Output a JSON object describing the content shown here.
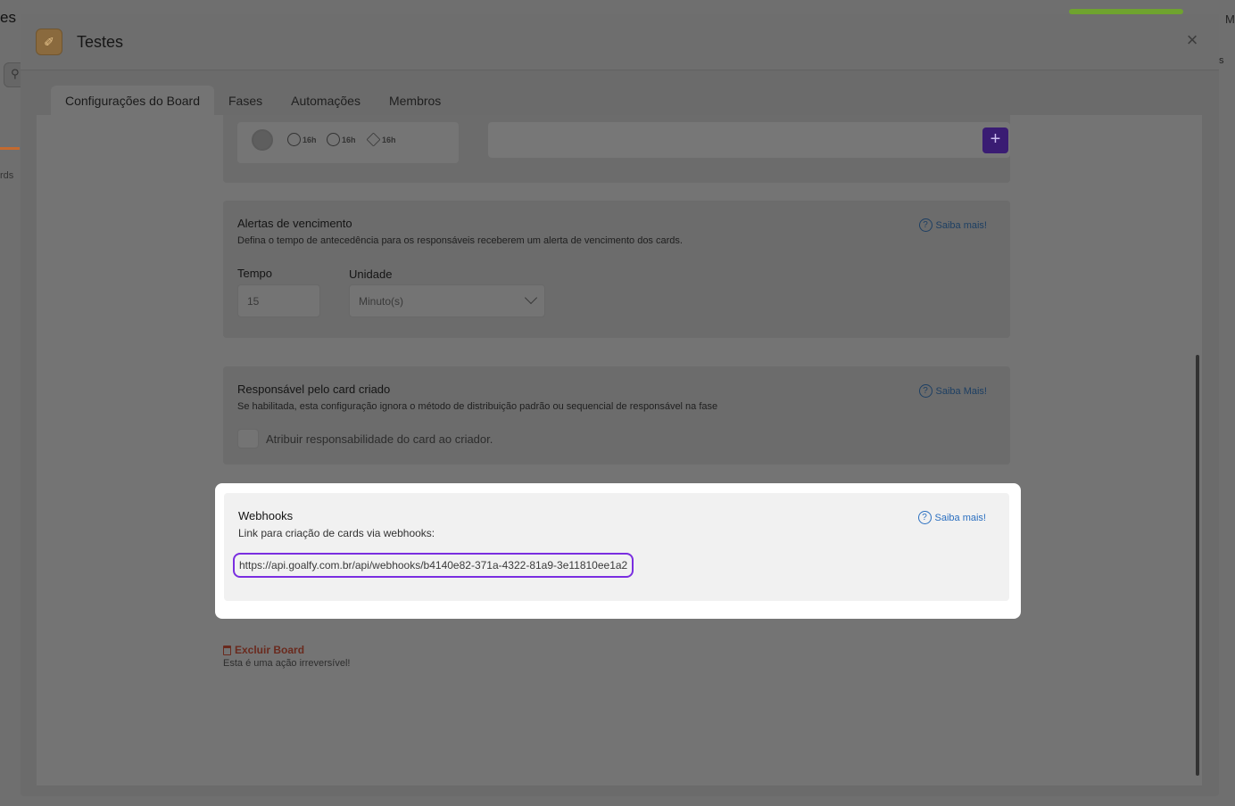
{
  "background": {
    "title_fragment": "es",
    "cards_fragment": "rds",
    "m_fragment": "M",
    "s_fragment": "s",
    "search_icon": "search-icon"
  },
  "modal": {
    "title": "Testes",
    "close_icon": "×",
    "board_icon": "✐"
  },
  "tabs": [
    {
      "label": "Configurações do Board",
      "active": true
    },
    {
      "label": "Fases",
      "active": false
    },
    {
      "label": "Automações",
      "active": false
    },
    {
      "label": "Membros",
      "active": false
    }
  ],
  "phase_preview": {
    "times": [
      "16h",
      "16h",
      "16h"
    ],
    "add_label": "+"
  },
  "due_alerts": {
    "title": "Alertas de vencimento",
    "description": "Defina o tempo de antecedência para os responsáveis receberem um alerta de vencimento dos cards.",
    "help": "Saiba mais!",
    "time_label": "Tempo",
    "time_value": "15",
    "unit_label": "Unidade",
    "unit_value": "Minuto(s)"
  },
  "creator_owner": {
    "title": "Responsável pelo card criado",
    "description": "Se habilitada, esta configuração ignora o método de distribuição padrão ou sequencial de responsável na fase",
    "help": "Saiba Mais!",
    "checkbox_label": "Atribuir responsabilidade do card ao criador.",
    "checked": false
  },
  "webhooks": {
    "title": "Webhooks",
    "description": "Link para criação de cards via webhooks:",
    "help": "Saiba mais!",
    "url": "https://api.goalfy.com.br/api/webhooks/b4140e82-371a-4322-81a9-3e11810ee1a2"
  },
  "danger": {
    "delete_label": "Excluir Board",
    "note": "Esta é uma ação irreversível!"
  },
  "colors": {
    "accent": "#7a2ee0",
    "link": "#2a6fc0",
    "danger": "#c0392b"
  }
}
